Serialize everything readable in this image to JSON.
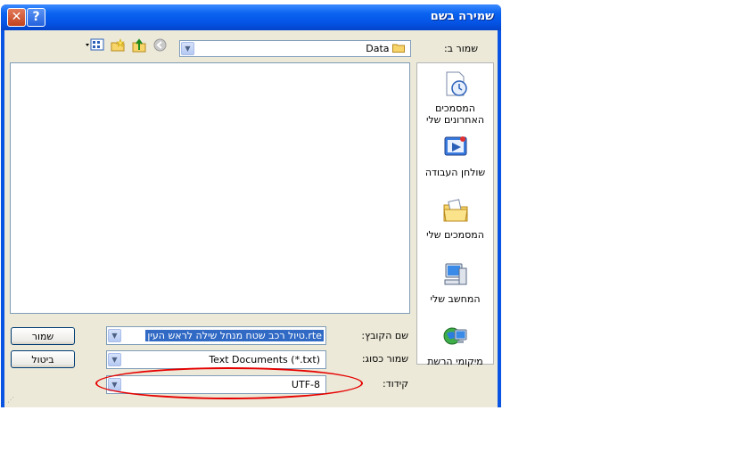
{
  "window": {
    "title": "שמירה בשם",
    "close_glyph": "✕",
    "help_glyph": "?"
  },
  "save_in": {
    "label": "שמור ב:",
    "value": "Data",
    "folder_icon": "folder-icon"
  },
  "toolbar": {
    "icons": [
      "back-icon",
      "up-folder-icon",
      "new-folder-icon",
      "views-icon"
    ]
  },
  "places": [
    {
      "label_line1": "המסמכים",
      "label_line2": "האחרונים שלי",
      "icon": "recent-documents-icon"
    },
    {
      "label_line1": "שולחן העבודה",
      "label_line2": "",
      "icon": "desktop-icon"
    },
    {
      "label_line1": "המסמכים שלי",
      "label_line2": "",
      "icon": "my-documents-icon"
    },
    {
      "label_line1": "המחשב שלי",
      "label_line2": "",
      "icon": "my-computer-icon"
    },
    {
      "label_line1": "מיקומי הרשת",
      "label_line2": "",
      "icon": "network-places-icon"
    }
  ],
  "fields": {
    "filename_label": "שם הקובץ:",
    "filename_value": "טיול רכב שטח מנחל שילה לראש העין.rte",
    "savetype_label": "שמור כסוג:",
    "savetype_value": "Text Documents (*.txt)",
    "encoding_label": "קידוד:",
    "encoding_value": "UTF-8"
  },
  "buttons": {
    "save": "שמור",
    "cancel": "ביטול"
  },
  "colors": {
    "title_bar": "#0554e6",
    "dialog_bg": "#ece9d8",
    "highlight": "#316ac5",
    "annotation": "#e60000"
  }
}
